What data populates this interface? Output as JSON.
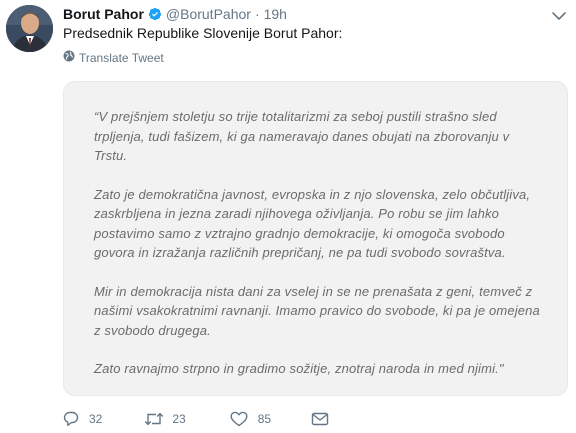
{
  "author": {
    "name": "Borut Pahor",
    "handle": "@BorutPahor",
    "separator": "·",
    "time": "19h"
  },
  "tweet_text": "Predsednik Republike Slovenije Borut Pahor:",
  "translate_label": "Translate Tweet",
  "quote": {
    "paragraphs": [
      [
        "“V prejšnjem stoletju so trije totalitarizmi za seboj pustili strašno sled",
        "trpljenja, tudi fašizem, ki ga nameravajo danes obujati na zborovanju v",
        "Trstu."
      ],
      [
        "Zato je demokratična javnost, evropska in z njo slovenska, zelo občutljiva,",
        "zaskrbljena in jezna zaradi njihovega oživljanja. Po robu se jim lahko",
        "postavimo samo z vztrajno gradnjo demokracije, ki omogoča svobodo",
        "govora in izražanja različnih prepričanj, ne pa tudi svobodo sovraštva."
      ],
      [
        "Mir in demokracija nista dani za vselej in se ne prenašata z geni, temveč z",
        "našimi vsakokratnimi ravnanji. Imamo pravico do svobode, ki pa je omejena",
        "z svobodo drugega."
      ],
      [
        "Zato ravnajmo strpno in gradimo sožitje, znotraj naroda in med njimi.\""
      ]
    ]
  },
  "actions": {
    "reply_count": "32",
    "retweet_count": "23",
    "like_count": "85"
  },
  "colors": {
    "verified": "#1da1f2",
    "secondary_text": "#657786",
    "card_background": "#f2f2f2"
  },
  "icons": {
    "verified": "verified-badge-icon",
    "caret": "chevron-down-icon",
    "translate": "globe-icon",
    "reply": "reply-icon",
    "retweet": "retweet-icon",
    "like": "heart-icon",
    "dm": "envelope-icon"
  }
}
